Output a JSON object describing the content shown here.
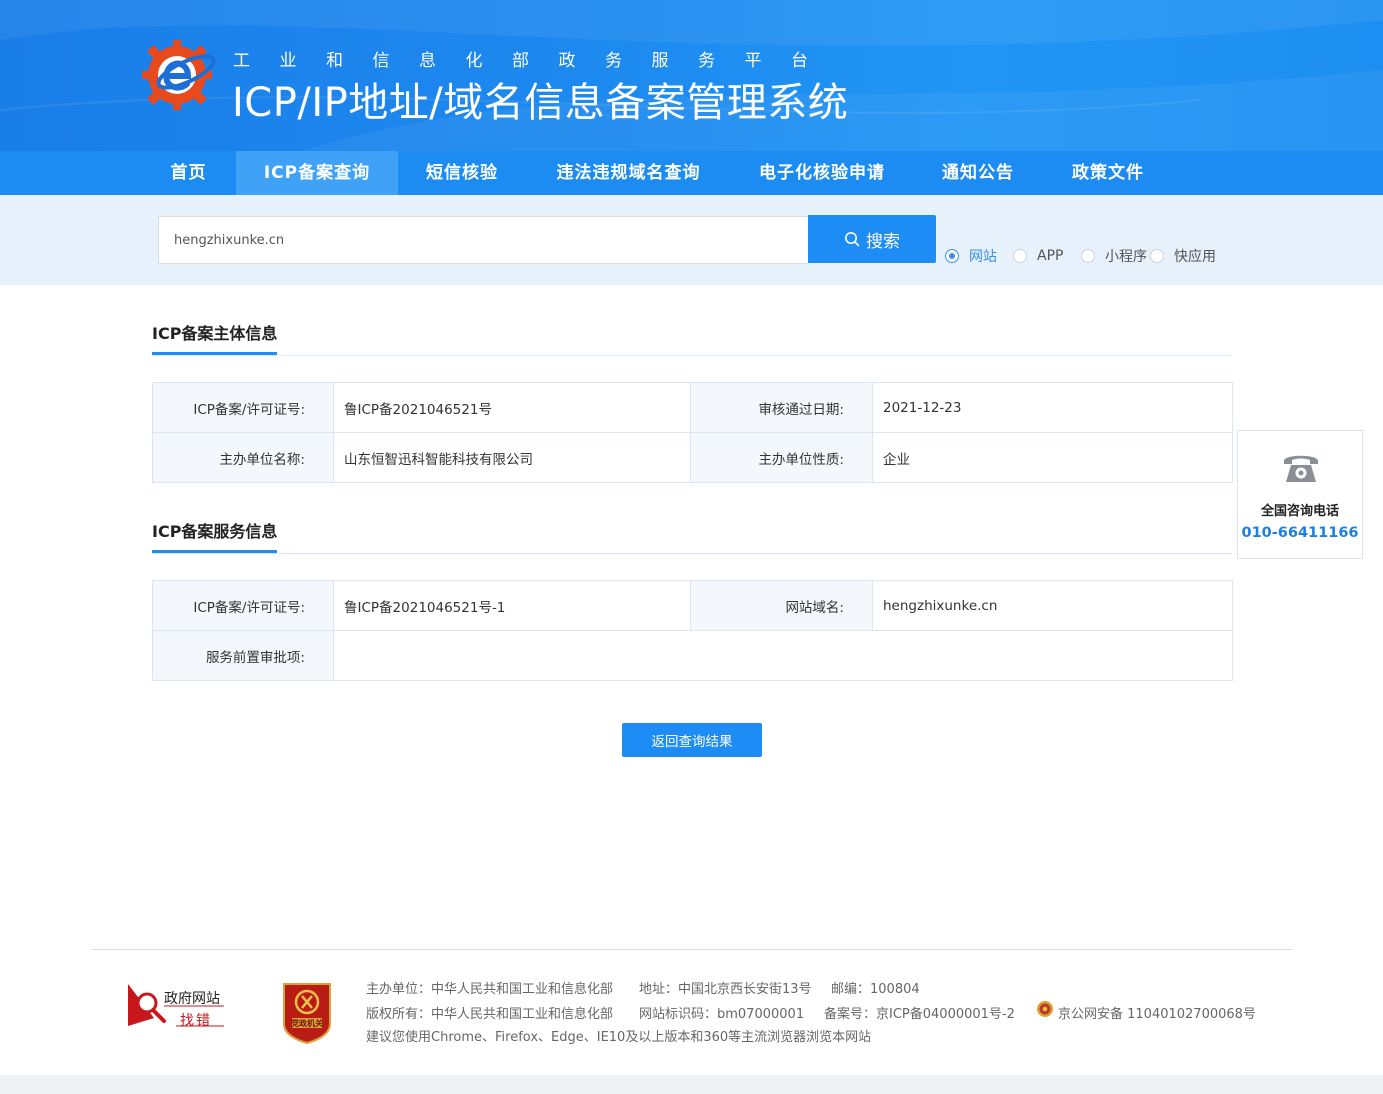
{
  "header": {
    "subtitle": "工业和信息化部政务服务平台",
    "title": "ICP/IP地址/域名信息备案管理系统"
  },
  "nav": {
    "items": [
      {
        "label": "首页",
        "active": false
      },
      {
        "label": "ICP备案查询",
        "active": true
      },
      {
        "label": "短信核验",
        "active": false
      },
      {
        "label": "违法违规域名查询",
        "active": false
      },
      {
        "label": "电子化核验申请",
        "active": false
      },
      {
        "label": "通知公告",
        "active": false
      },
      {
        "label": "政策文件",
        "active": false
      }
    ]
  },
  "search": {
    "value": "hengzhixunke.cn",
    "button_label": "搜索",
    "types": [
      {
        "label": "网站",
        "checked": true
      },
      {
        "label": "APP",
        "checked": false
      },
      {
        "label": "小程序",
        "checked": false
      },
      {
        "label": "快应用",
        "checked": false
      }
    ]
  },
  "subject_section": {
    "title": "ICP备案主体信息",
    "rows": [
      {
        "label1": "ICP备案/许可证号:",
        "value1": "鲁ICP备2021046521号",
        "label2": "审核通过日期:",
        "value2": "2021-12-23"
      },
      {
        "label1": "主办单位名称:",
        "value1": "山东恒智迅科智能科技有限公司",
        "label2": "主办单位性质:",
        "value2": "企业"
      }
    ]
  },
  "service_section": {
    "title": "ICP备案服务信息",
    "row1": {
      "label1": "ICP备案/许可证号:",
      "value1": "鲁ICP备2021046521号-1",
      "label2": "网站域名:",
      "value2": "hengzhixunke.cn"
    },
    "row2": {
      "label1": "服务前置审批项:",
      "value1": ""
    }
  },
  "back_button": "返回查询结果",
  "contact": {
    "label": "全国咨询电话",
    "number": "010-66411166",
    "icon": "telephone-icon"
  },
  "footer": {
    "badge1_line1": "政府网站",
    "badge1_line2": "找错",
    "badge2_text": "党政机关",
    "line1": [
      "主办单位：中华人民共和国工业和信息化部",
      "地址：中国北京西长安街13号",
      "邮编：100804"
    ],
    "line2": [
      "版权所有：中华人民共和国工业和信息化部",
      "网站标识码：bm07000001",
      "备案号：京ICP备04000001号-2",
      "京公网安备 11040102700068号"
    ],
    "line3": "建议您使用Chrome、Firefox、Edge、IE10及以上版本和360等主流浏览器浏览本网站"
  },
  "colors": {
    "brand_blue": "#1d8cf5",
    "nav_active": "#3fa2f7",
    "contact_number": "#1d7fe0"
  }
}
